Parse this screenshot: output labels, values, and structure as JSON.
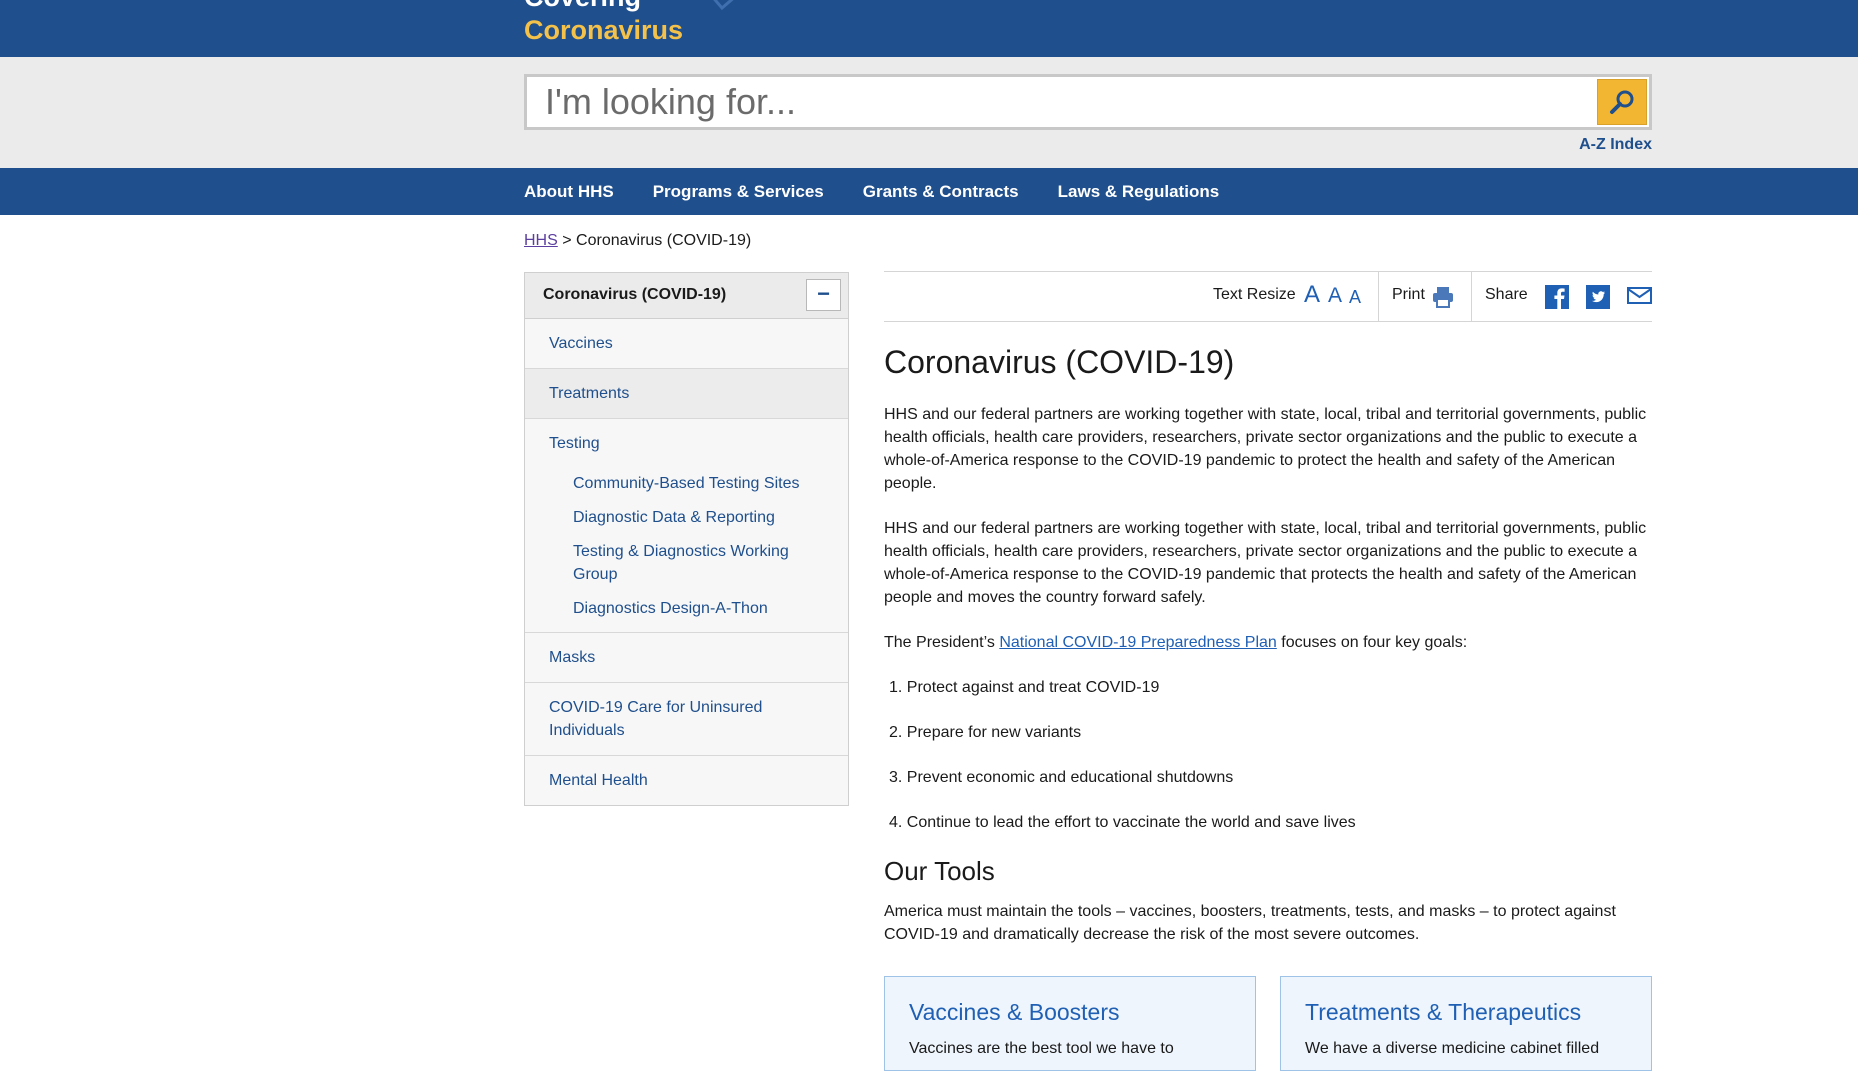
{
  "header": {
    "partial_title": "Covering",
    "site_title": "Coronavirus"
  },
  "search": {
    "placeholder": "I'm looking for...",
    "az_index": "A-Z Index"
  },
  "nav": {
    "items": [
      "About HHS",
      "Programs & Services",
      "Grants & Contracts",
      "Laws & Regulations"
    ]
  },
  "breadcrumb": {
    "home": "HHS",
    "separator": ">",
    "current": "Coronavirus (COVID-19)"
  },
  "sidebar": {
    "title": "Coronavirus (COVID-19)",
    "toggle": "−",
    "items": [
      {
        "label": "Vaccines"
      },
      {
        "label": "Treatments"
      },
      {
        "label": "Testing",
        "children": [
          "Community-Based Testing Sites",
          "Diagnostic Data & Reporting",
          "Testing & Diagnostics Working Group",
          "Diagnostics Design-A-Thon"
        ]
      },
      {
        "label": "Masks"
      },
      {
        "label": "COVID-19 Care for Uninsured Individuals"
      },
      {
        "label": "Mental Health"
      }
    ]
  },
  "toolbar": {
    "text_resize": "Text Resize",
    "sizes": [
      "A",
      "A",
      "A"
    ],
    "print": "Print",
    "share": "Share",
    "icons": [
      "print-icon",
      "facebook-icon",
      "twitter-icon",
      "email-icon"
    ]
  },
  "main": {
    "title": "Coronavirus (COVID-19)",
    "para1": "HHS and our federal partners are working together with state, local, tribal and territorial governments, public health officials, health care providers, researchers, private sector organizations and the public to execute a whole-of-America response to the COVID-19 pandemic to protect the health and safety of the American people.",
    "para2": "HHS and our federal partners are working together with state, local, tribal and territorial governments, public health officials, health care providers, researchers, private sector organizations and the public to execute a whole-of-America response to the COVID-19 pandemic that protects the health and safety of the American people and moves the country forward safely.",
    "para3_before": "The President’s ",
    "para3_link": "National COVID-19 Preparedness Plan",
    "para3_after": " focuses on four key goals:",
    "goals": [
      "1. Protect against and treat COVID-19",
      "2. Prepare for new variants",
      "3. Prevent economic and educational shutdowns",
      "4. Continue to lead the effort to vaccinate the world and save lives"
    ],
    "tools_title": "Our Tools",
    "tools_text": "America must maintain the tools – vaccines, boosters, treatments, tests, and masks – to protect against COVID-19 and dramatically decrease the risk of the most severe outcomes."
  },
  "cards": [
    {
      "title": "Vaccines & Boosters",
      "text": "Vaccines are the best tool we have to"
    },
    {
      "title": "Treatments & Therapeutics",
      "text": "We have a diverse medicine cabinet filled"
    }
  ],
  "colors": {
    "brand_blue": "#1f4f8c",
    "accent_gold": "#f2b632",
    "link_blue": "#1f5fb4"
  }
}
